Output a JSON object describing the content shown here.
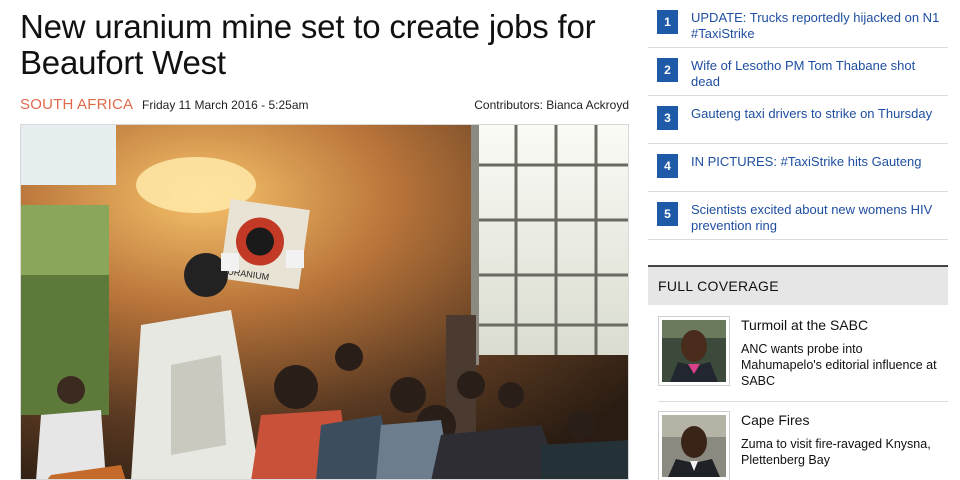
{
  "article": {
    "headline": "New uranium mine set to create jobs for Beaufort West",
    "section": "SOUTH AFRICA",
    "date": "Friday 11 March 2016 - 5:25am",
    "contributors": "Contributors: Bianca Ackroyd",
    "sign_text": "URANIUM"
  },
  "sidebar": {
    "trending": [
      {
        "number": "1",
        "title": "UPDATE: Trucks reportedly hijacked on N1 #TaxiStrike"
      },
      {
        "number": "2",
        "title": "Wife of Lesotho PM Tom Thabane shot dead"
      },
      {
        "number": "3",
        "title": "Gauteng taxi drivers to strike on Thursday"
      },
      {
        "number": "4",
        "title": "IN PICTURES: #TaxiStrike hits Gauteng"
      },
      {
        "number": "5",
        "title": "Scientists excited about new womens HIV prevention ring"
      }
    ],
    "full_coverage": {
      "heading": "FULL COVERAGE",
      "items": [
        {
          "title": "Turmoil at the SABC",
          "description": "ANC wants probe into Mahumapelo's editorial influence at SABC"
        },
        {
          "title": "Cape Fires",
          "description": "Zuma to visit fire-ravaged Knysna, Plettenberg Bay"
        }
      ]
    }
  },
  "colors": {
    "section_accent": "#e06a4b",
    "link_blue": "#1f4fa0",
    "badge_blue": "#1f5aa8"
  }
}
